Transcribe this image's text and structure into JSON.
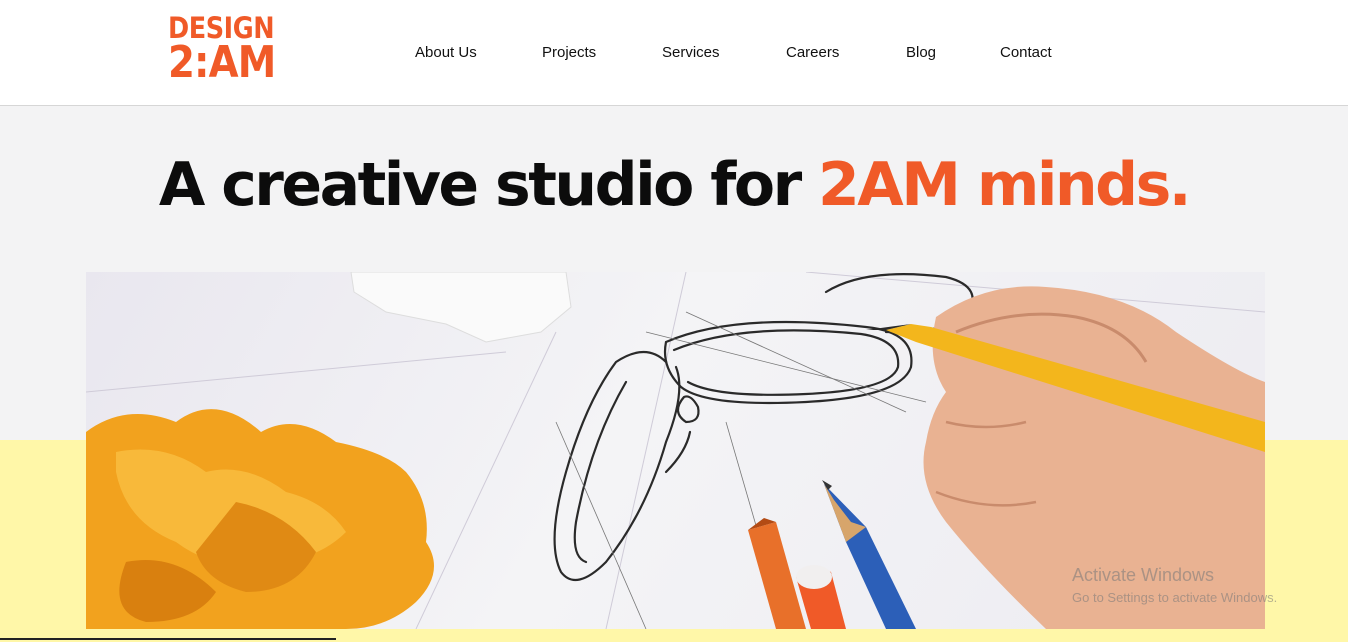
{
  "brand": {
    "line1": "DESIGN",
    "line2": "2:AM"
  },
  "nav": {
    "items": [
      "About Us",
      "Projects",
      "Services",
      "Careers",
      "Blog",
      "Contact"
    ]
  },
  "hero": {
    "title_main": "A creative studio for ",
    "title_accent": "2AM minds."
  },
  "watermark": {
    "line1": "Activate Windows",
    "line2": "Go to Settings to activate Windows."
  },
  "colors": {
    "accent": "#f05a28",
    "page_bg": "#f3f3f4",
    "yellow_band": "#fff7a8",
    "header_bg": "#ffffff"
  },
  "icons": [
    "sketch-glasses-photo"
  ]
}
